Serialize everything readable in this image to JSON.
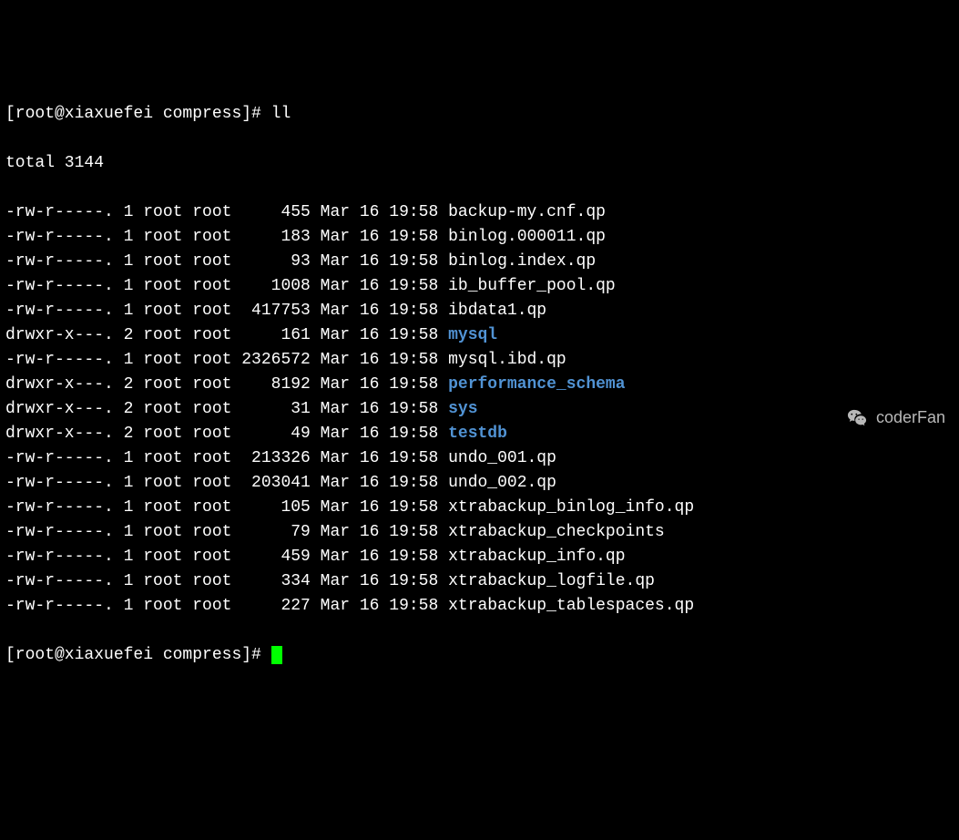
{
  "prompt1": "[root@xiaxuefei compress]# ll",
  "total_line": "total 3144",
  "files": [
    {
      "perms": "-rw-r-----.",
      "links": "1",
      "owner": "root",
      "group": "root",
      "size": "    455",
      "date": "Mar 16 19:58",
      "name": "backup-my.cnf.qp",
      "is_dir": false
    },
    {
      "perms": "-rw-r-----.",
      "links": "1",
      "owner": "root",
      "group": "root",
      "size": "    183",
      "date": "Mar 16 19:58",
      "name": "binlog.000011.qp",
      "is_dir": false
    },
    {
      "perms": "-rw-r-----.",
      "links": "1",
      "owner": "root",
      "group": "root",
      "size": "     93",
      "date": "Mar 16 19:58",
      "name": "binlog.index.qp",
      "is_dir": false
    },
    {
      "perms": "-rw-r-----.",
      "links": "1",
      "owner": "root",
      "group": "root",
      "size": "   1008",
      "date": "Mar 16 19:58",
      "name": "ib_buffer_pool.qp",
      "is_dir": false
    },
    {
      "perms": "-rw-r-----.",
      "links": "1",
      "owner": "root",
      "group": "root",
      "size": " 417753",
      "date": "Mar 16 19:58",
      "name": "ibdata1.qp",
      "is_dir": false
    },
    {
      "perms": "drwxr-x---.",
      "links": "2",
      "owner": "root",
      "group": "root",
      "size": "    161",
      "date": "Mar 16 19:58",
      "name": "mysql",
      "is_dir": true
    },
    {
      "perms": "-rw-r-----.",
      "links": "1",
      "owner": "root",
      "group": "root",
      "size": "2326572",
      "date": "Mar 16 19:58",
      "name": "mysql.ibd.qp",
      "is_dir": false
    },
    {
      "perms": "drwxr-x---.",
      "links": "2",
      "owner": "root",
      "group": "root",
      "size": "   8192",
      "date": "Mar 16 19:58",
      "name": "performance_schema",
      "is_dir": true
    },
    {
      "perms": "drwxr-x---.",
      "links": "2",
      "owner": "root",
      "group": "root",
      "size": "     31",
      "date": "Mar 16 19:58",
      "name": "sys",
      "is_dir": true
    },
    {
      "perms": "drwxr-x---.",
      "links": "2",
      "owner": "root",
      "group": "root",
      "size": "     49",
      "date": "Mar 16 19:58",
      "name": "testdb",
      "is_dir": true
    },
    {
      "perms": "-rw-r-----.",
      "links": "1",
      "owner": "root",
      "group": "root",
      "size": " 213326",
      "date": "Mar 16 19:58",
      "name": "undo_001.qp",
      "is_dir": false
    },
    {
      "perms": "-rw-r-----.",
      "links": "1",
      "owner": "root",
      "group": "root",
      "size": " 203041",
      "date": "Mar 16 19:58",
      "name": "undo_002.qp",
      "is_dir": false
    },
    {
      "perms": "-rw-r-----.",
      "links": "1",
      "owner": "root",
      "group": "root",
      "size": "    105",
      "date": "Mar 16 19:58",
      "name": "xtrabackup_binlog_info.qp",
      "is_dir": false
    },
    {
      "perms": "-rw-r-----.",
      "links": "1",
      "owner": "root",
      "group": "root",
      "size": "     79",
      "date": "Mar 16 19:58",
      "name": "xtrabackup_checkpoints",
      "is_dir": false
    },
    {
      "perms": "-rw-r-----.",
      "links": "1",
      "owner": "root",
      "group": "root",
      "size": "    459",
      "date": "Mar 16 19:58",
      "name": "xtrabackup_info.qp",
      "is_dir": false
    },
    {
      "perms": "-rw-r-----.",
      "links": "1",
      "owner": "root",
      "group": "root",
      "size": "    334",
      "date": "Mar 16 19:58",
      "name": "xtrabackup_logfile.qp",
      "is_dir": false
    },
    {
      "perms": "-rw-r-----.",
      "links": "1",
      "owner": "root",
      "group": "root",
      "size": "    227",
      "date": "Mar 16 19:58",
      "name": "xtrabackup_tablespaces.qp",
      "is_dir": false
    }
  ],
  "prompt2": "[root@xiaxuefei compress]# ",
  "watermark_text": "coderFan"
}
